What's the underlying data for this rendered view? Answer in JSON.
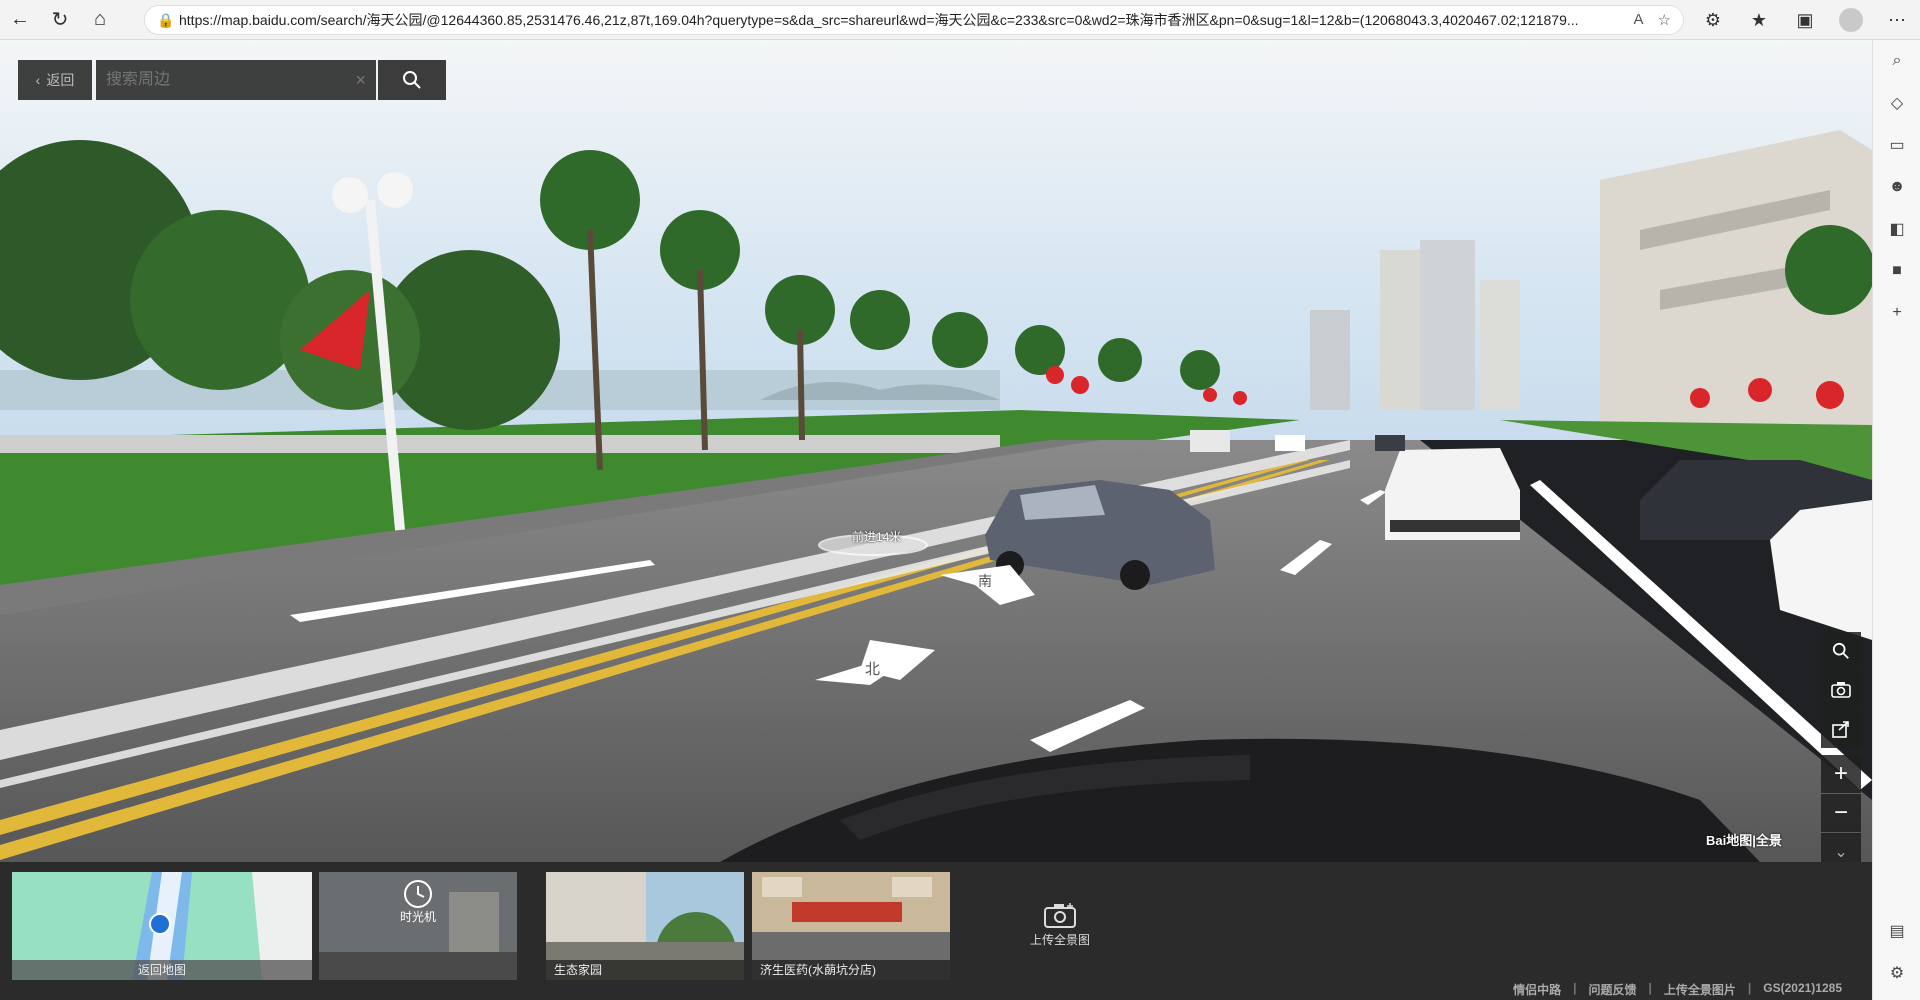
{
  "browser": {
    "url": "https://map.baidu.com/search/海天公园/@12644360.85,2531476.46,21z,87t,169.04h?querytype=s&da_src=shareurl&wd=海天公园&c=233&src=0&wd2=珠海市香洲区&pn=0&sug=1&l=12&b=(12068043.3,4020467.02;121879..."
  },
  "overlay": {
    "back_label": "返回",
    "search_placeholder": "搜索周边"
  },
  "pano": {
    "forward_label": "前进14米",
    "arrow_north": "北",
    "arrow_south": "南",
    "watermark": "Bai地图|全景"
  },
  "thumbnails": {
    "map_label": "返回地图",
    "time_label": "时光机",
    "poi_a": "生态家园",
    "poi_b": "济生医药(水蓢坑分店)",
    "upload_label": "上传全景图"
  },
  "footer": {
    "link1": "情侣中路",
    "link2": "问题反馈",
    "link3": "上传全景图片",
    "license": "GS(2021)1285"
  },
  "colors": {
    "sky": "#dbe9f4",
    "grass": "#3f8a2e",
    "road": "#6b6b6b",
    "line_yellow": "#e2b83a",
    "ui_dark": "#1e1e1e"
  }
}
